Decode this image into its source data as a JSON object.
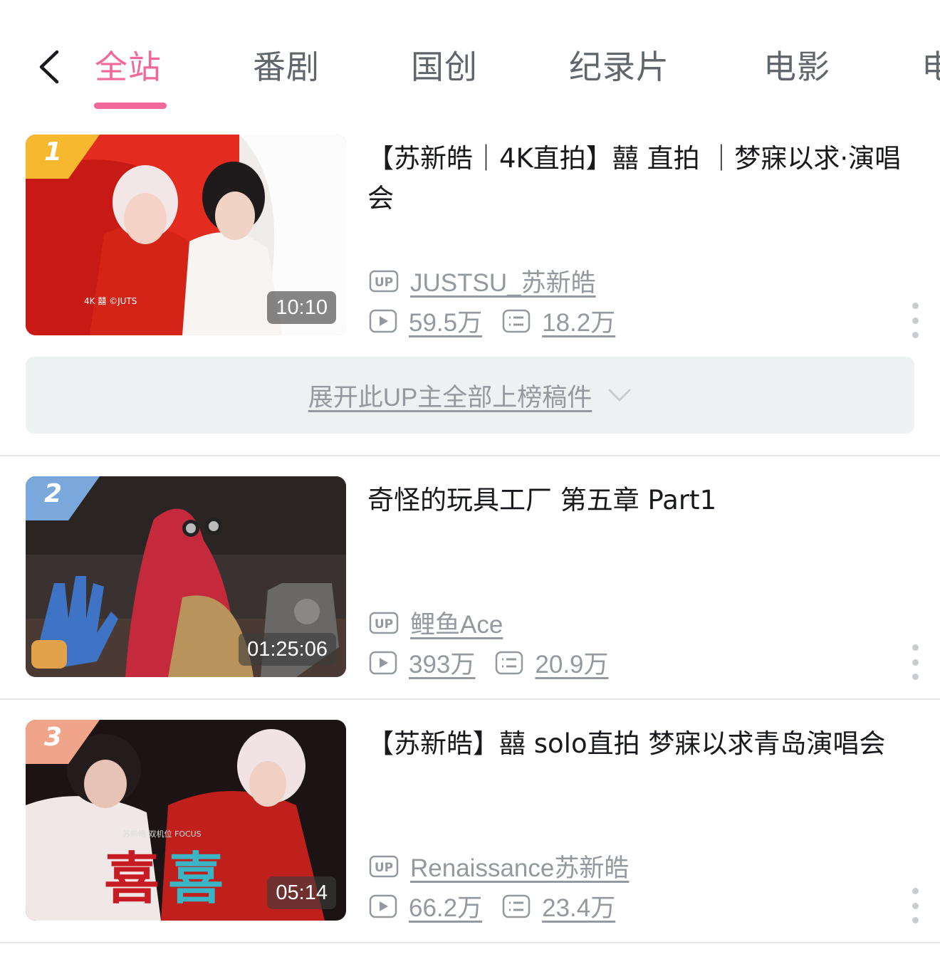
{
  "tabs": [
    {
      "label": "全站",
      "active": true
    },
    {
      "label": "番剧"
    },
    {
      "label": "国创"
    },
    {
      "label": "纪录片"
    },
    {
      "label": "电影"
    },
    {
      "label": "电"
    }
  ],
  "accent_color": "#f0699a",
  "expand_label": "展开此UP主全部上榜稿件",
  "videos": [
    {
      "rank": "1",
      "duration": "10:10",
      "title": "【苏新皓｜4K直拍】囍 直拍 ｜梦寐以求·演唱会",
      "uploader": "JUSTSU_苏新皓",
      "views": "59.5万",
      "danmaku": "18.2万",
      "badge_color": "#f5b82e"
    },
    {
      "rank": "2",
      "duration": "01:25:06",
      "title": "奇怪的玩具工厂 第五章 Part1",
      "uploader": "鲤鱼Ace",
      "views": "393万",
      "danmaku": "20.9万",
      "badge_color": "#7aa8dd"
    },
    {
      "rank": "3",
      "duration": "05:14",
      "title": "【苏新皓】囍 solo直拍 梦寐以求青岛演唱会",
      "uploader": "Renaissance苏新皓",
      "views": "66.2万",
      "danmaku": "23.4万",
      "badge_color": "#f0a48a"
    }
  ]
}
